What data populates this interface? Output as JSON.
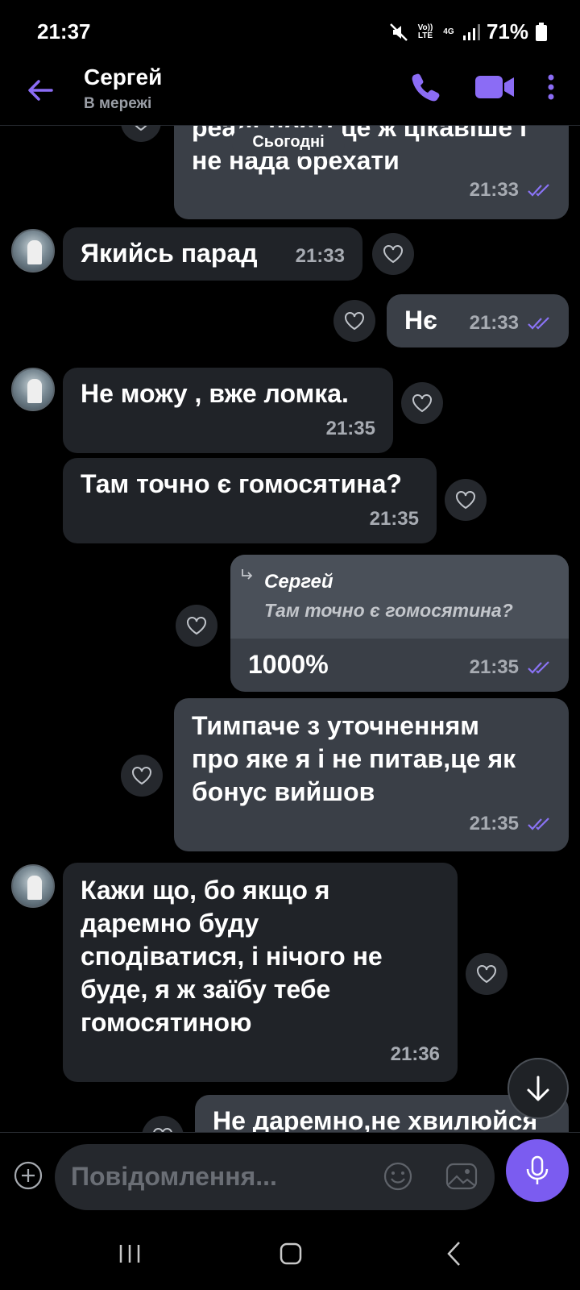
{
  "status_bar": {
    "time": "21:37",
    "volte": "Vo)) LTE",
    "network": "4G",
    "battery": "71%"
  },
  "header": {
    "contact_name": "Сергей",
    "contact_status": "В мережі"
  },
  "chat": {
    "date_chip": "Сьогодні",
    "messages": [
      {
        "direction": "out",
        "text_line1": "реальності це ж цікавіше і",
        "text_line2": "не нада брехати",
        "time": "21:33"
      },
      {
        "direction": "in",
        "text": "Якийсь парад",
        "time": "21:33"
      },
      {
        "direction": "out",
        "text": "Нє",
        "time": "21:33"
      },
      {
        "direction": "in",
        "text": "Не можу , вже ломка.",
        "time": "21:35"
      },
      {
        "direction": "in",
        "text": "Там точно є гомосятина?",
        "time": "21:35"
      },
      {
        "direction": "out",
        "quote_author": "Сергей",
        "quote_text": "Там точно є гомосятина?",
        "text": "1000%",
        "time": "21:35"
      },
      {
        "direction": "out",
        "text_line1": "Тимпаче з уточненням",
        "text_line2": "про яке я і не питав,це як",
        "text_line3": "бонус вийшов",
        "time": "21:35"
      },
      {
        "direction": "in",
        "text_line1": "Кажи що, бо якщо я",
        "text_line2": "даремно буду",
        "text_line3": "сподіватися, і нічого не",
        "text_line4": "буде, я ж заїбу тебе",
        "text_line5": "гомосятиною",
        "time": "21:36"
      },
      {
        "direction": "out",
        "text": "Не даремно,не хвилюйся"
      }
    ]
  },
  "composer": {
    "placeholder": "Повідомлення..."
  },
  "colors": {
    "accent": "#7b5cf0",
    "incoming_bubble": "#202328",
    "outgoing_bubble": "#3a3f47",
    "read_ticks": "#8a73f5"
  }
}
